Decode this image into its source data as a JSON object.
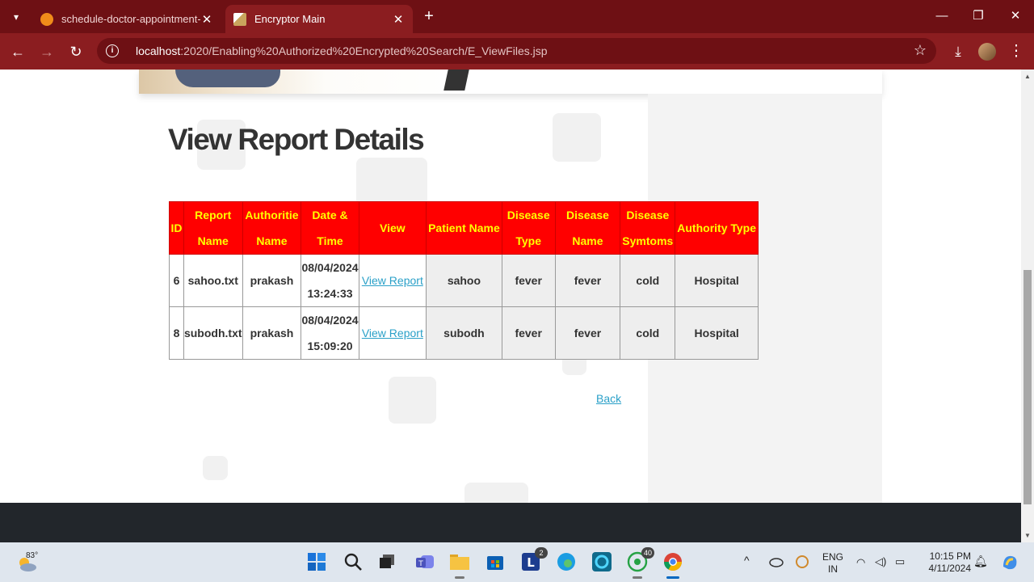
{
  "browser": {
    "tabs": [
      {
        "title": "schedule-doctor-appointment-",
        "active": false
      },
      {
        "title": "Encryptor Main",
        "active": true
      }
    ],
    "address": {
      "host": "localhost",
      "path": ":2020/Enabling%20Authorized%20Encrypted%20Search/E_ViewFiles.jsp"
    },
    "theme_color": "#8b1d20",
    "icons": [
      "tab-list-icon",
      "close-icon",
      "new-tab-icon",
      "minimize-icon",
      "restore-icon",
      "back-arrow-icon",
      "forward-arrow-icon",
      "reload-icon",
      "site-info-icon",
      "bookmark-star-icon",
      "download-icon",
      "profile-avatar",
      "more-menu-icon"
    ]
  },
  "page": {
    "title": "View Report Details",
    "table": {
      "headers": [
        [
          "ID"
        ],
        [
          "Report",
          "Name"
        ],
        [
          "Authoritie",
          "Name"
        ],
        [
          "Date &",
          "Time"
        ],
        [
          "View"
        ],
        [
          "Patient Name"
        ],
        [
          "Disease",
          "Type"
        ],
        [
          "Disease",
          "Name"
        ],
        [
          "Disease",
          "Symtoms"
        ],
        [
          "Authority Type"
        ]
      ],
      "rows": [
        {
          "id": "6",
          "report_name": "sahoo.txt",
          "authority_name": "prakash",
          "date": "08/04/2024",
          "time": "13:24:33",
          "view": "View Report",
          "patient_name": "sahoo",
          "disease_type": "fever",
          "disease_name": "fever",
          "disease_symptoms": "cold",
          "authority_type": "Hospital"
        },
        {
          "id": "8",
          "report_name": "subodh.txt",
          "authority_name": "prakash",
          "date": "08/04/2024",
          "time": "15:09:20",
          "view": "View Report",
          "patient_name": "subodh",
          "disease_type": "fever",
          "disease_name": "fever",
          "disease_symptoms": "cold",
          "authority_type": "Hospital"
        }
      ],
      "header_bg": "#ff0000",
      "header_text": "#ffff00"
    },
    "back_link": "Back",
    "link_color": "#2aa0c8"
  },
  "taskbar": {
    "weather": {
      "temp": "83°"
    },
    "apps": [
      {
        "name": "start-icon"
      },
      {
        "name": "search-icon"
      },
      {
        "name": "task-view-icon"
      },
      {
        "name": "teams-icon"
      },
      {
        "name": "file-explorer-icon",
        "running": true
      },
      {
        "name": "store-icon"
      },
      {
        "name": "l-app-icon",
        "badge": "2"
      },
      {
        "name": "edge-icon"
      },
      {
        "name": "cortana-icon"
      },
      {
        "name": "whatsapp-icon",
        "badge": "40",
        "running": true
      },
      {
        "name": "chrome-icon",
        "running": true,
        "active": true
      }
    ],
    "tray": {
      "lang_top": "ENG",
      "lang_bottom": "IN",
      "time": "10:15 PM",
      "date": "4/11/2024"
    }
  }
}
